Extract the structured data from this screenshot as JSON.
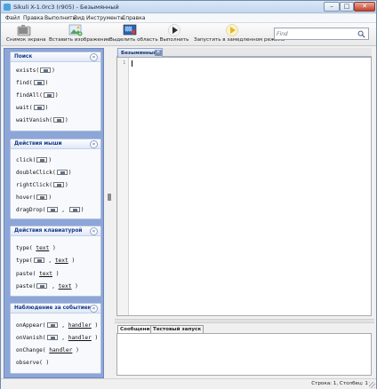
{
  "window": {
    "title": "Sikuli X-1.0rc3 (r905) - Безымянный",
    "controls": {
      "minimize": "–",
      "maximize": "□",
      "close": "✕"
    }
  },
  "menu": [
    "Файл",
    "Правка",
    "Выполнить",
    "Вид",
    "Инструменты",
    "Справка"
  ],
  "toolbar": {
    "screenshot_label": "Снимок экрана",
    "insert_image_label": "Вставить изображение",
    "select_region_label": "Выделить область",
    "run_label": "Выполнить",
    "run_slow_label": "Запустить в замедленном режиме"
  },
  "search": {
    "placeholder": "Find",
    "value": ""
  },
  "sidebar": {
    "search": {
      "title": "Поиск",
      "items": [
        {
          "before": "exists(",
          "after": ")"
        },
        {
          "before": "find(",
          "after": ")"
        },
        {
          "before": "findAll(",
          "after": ")"
        },
        {
          "before": "wait(",
          "after": ")"
        },
        {
          "before": "waitVanish(",
          "after": ")"
        }
      ]
    },
    "mouse": {
      "title": "Действия мыши",
      "items": [
        {
          "before": "click(",
          "after": ")"
        },
        {
          "before": "doubleClick(",
          "after": ")"
        },
        {
          "before": "rightClick(",
          "after": ")"
        },
        {
          "before": "hover(",
          "after": ")"
        },
        {
          "before": "dragDrop(",
          "mid": " , ",
          "after": ")"
        }
      ]
    },
    "keyboard": {
      "title": "Действия клавиатурой",
      "items": [
        {
          "before": "type( ",
          "arg": "text",
          "after": " )"
        },
        {
          "before": "type(",
          "mid": " , ",
          "arg": "text",
          "after": " )"
        },
        {
          "before": "paste( ",
          "arg": "text",
          "after": " )"
        },
        {
          "before": "paste(",
          "mid": " , ",
          "arg": "text",
          "after": " )"
        }
      ]
    },
    "observe": {
      "title": "Наблюдение за событием",
      "items": [
        {
          "before": "onAppear(",
          "mid": " , ",
          "arg": "handler",
          "after": " )"
        },
        {
          "before": "onVanish(",
          "mid": " , ",
          "arg": "handler",
          "after": " )"
        },
        {
          "before": "onChange( ",
          "arg": "handler",
          "after": " )"
        },
        {
          "before": "observe( ",
          "after": ")"
        }
      ]
    },
    "collapse_glyph": "«"
  },
  "editor": {
    "tab_label": "Безымянный",
    "tab_close": "✕",
    "line_number": "1",
    "content": ""
  },
  "bottom": {
    "tabs": [
      "Сообщения",
      "Тестовый запуск"
    ]
  },
  "status": {
    "text": "Строка: 1, Столбец: 1"
  }
}
